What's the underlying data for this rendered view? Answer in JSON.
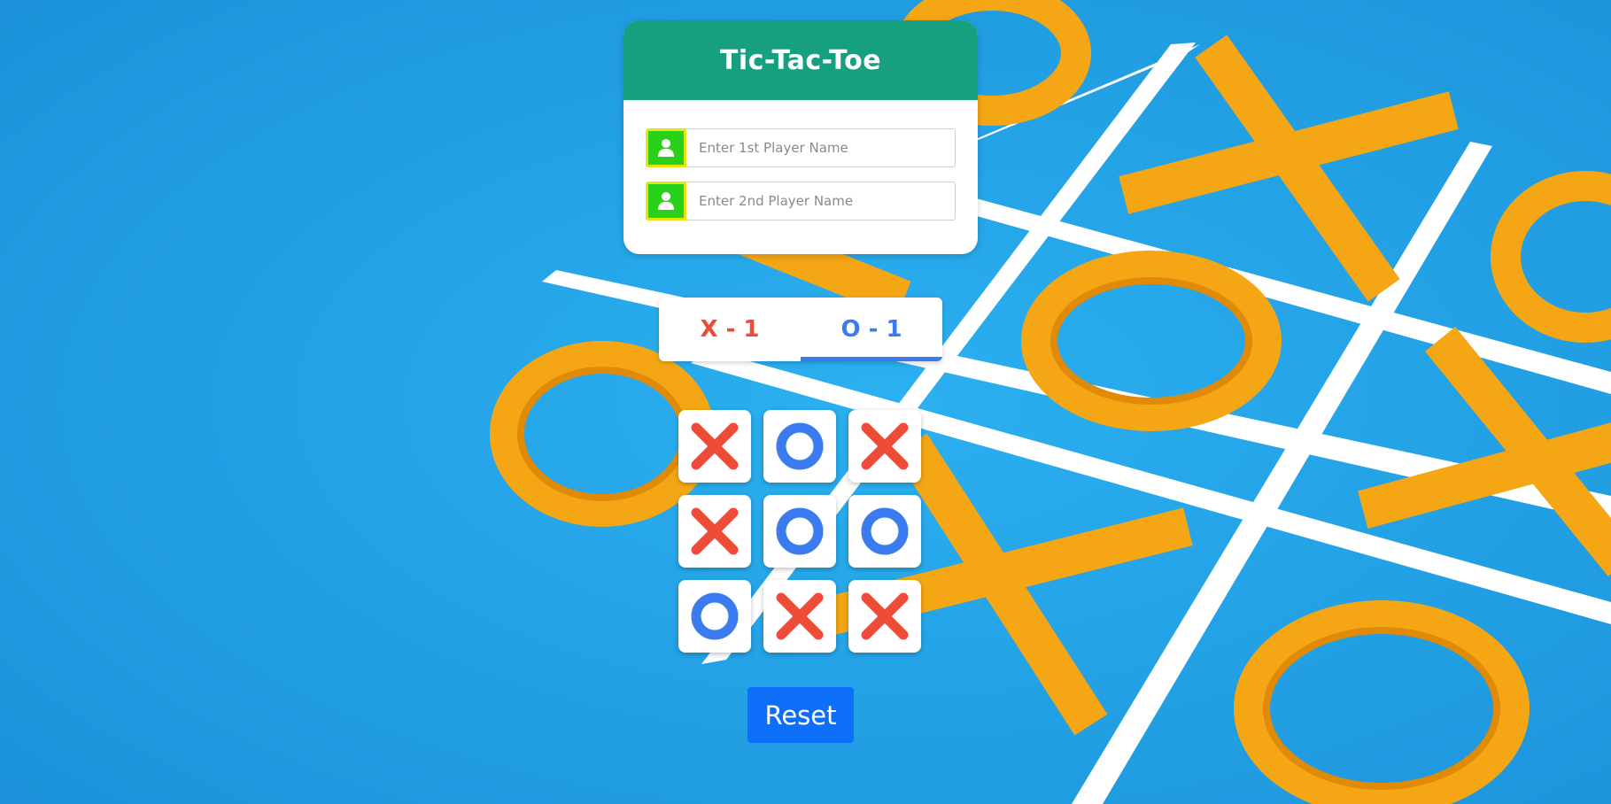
{
  "app": {
    "title": "Tic-Tac-Toe"
  },
  "players": {
    "player1": {
      "placeholder": "Enter 1st Player Name",
      "value": "",
      "icon": "user-icon"
    },
    "player2": {
      "placeholder": "Enter 2nd Player Name",
      "value": "",
      "icon": "user-icon"
    }
  },
  "score": {
    "x_label": "X - 1",
    "o_label": "O - 1",
    "active": "o"
  },
  "board": {
    "cells": [
      "X",
      "O",
      "X",
      "X",
      "O",
      "O",
      "O",
      "X",
      "X"
    ]
  },
  "controls": {
    "reset_label": "Reset"
  },
  "colors": {
    "header": "#17a080",
    "x_mark": "#f04a38",
    "o_mark": "#3a7cf0",
    "reset_button": "#0d6ef7",
    "icon_bg": "#2ad11a",
    "icon_border": "#e6e60d",
    "background": "#22a3e6"
  }
}
